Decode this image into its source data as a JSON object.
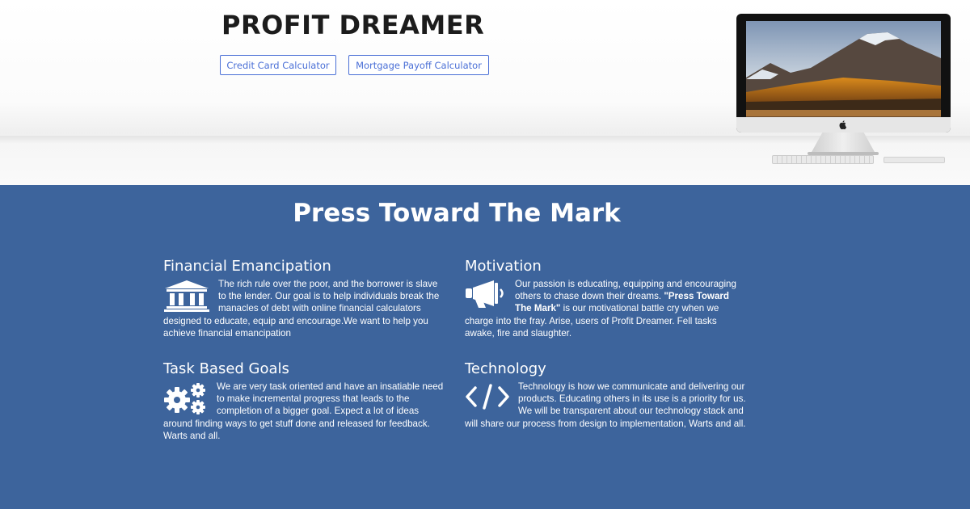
{
  "site": {
    "name": "PROFIT DREAMER",
    "nav_buttons": [
      {
        "label": "Credit Card Calculator"
      },
      {
        "label": "Mortgage Payoff Calculator"
      }
    ]
  },
  "colors": {
    "section_background": "#3d649c",
    "button_accent": "#4a6fd6",
    "logo_text": "#1c1c1c"
  },
  "section": {
    "title": "Press Toward The Mark",
    "features": [
      {
        "title": "Financial Emancipation",
        "icon": "bank-icon",
        "text": "The rich rule over the poor, and the borrower is slave to the lender. Our goal is to help individuals break the manacles of debt with online financial calculators designed to educate, equip and encourage.We want to help you achieve financial emancipation"
      },
      {
        "title": "Motivation",
        "icon": "megaphone-icon",
        "text_before": "Our passion is educating, equipping and encouraging others to chase down their dreams. ",
        "text_bold": "\"Press Toward The Mark\"",
        "text_after": " is our motivational battle cry when we charge into the fray. Arise, users of Profit Dreamer. Fell tasks awake, fire and slaughter."
      },
      {
        "title": "Task Based Goals",
        "icon": "gears-icon",
        "text": "We are very task oriented and have an insatiable need to make incremental progress that leads to the completion of a bigger goal. Expect a lot of ideas around finding ways to get stuff done and released for feedback. Warts and all."
      },
      {
        "title": "Technology",
        "icon": "code-icon",
        "text": "Technology is how we communicate and delivering our products. Educating others in its use is a priority for us. We will be transparent about our technology stack and will share our process from design to implementation, Warts and all."
      }
    ]
  }
}
